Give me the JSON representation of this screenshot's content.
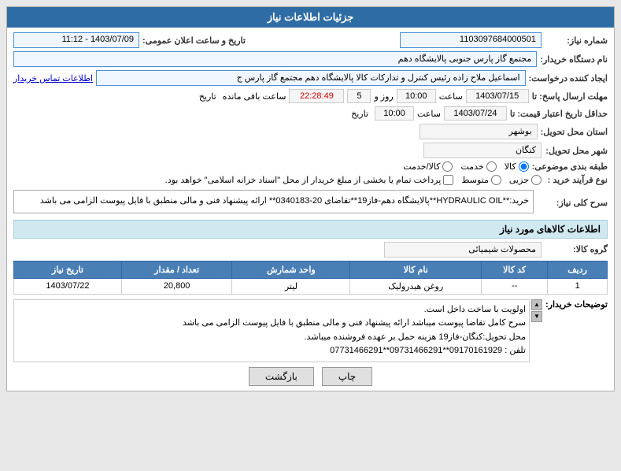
{
  "page": {
    "title": "جزئیات اطلاعات نیاز"
  },
  "fields": {
    "shomareNiaz_label": "شماره نیاز:",
    "shomareNiaz_value": "1103097684000501",
    "namDastgah_label": "نام دستگاه خریدار:",
    "namDastgah_value": "مجتمع گاز پارس جنوبی  پالایشگاه دهم",
    "ijadKonande_label": "ایجاد کننده درخواست:",
    "ijadKonande_value": "اسماعیل ملاح زاده رئیس کنترل و تدارکات کالا پالایشگاه دهم مجتمع گاز پارس ج",
    "etelaatTamas_text": "اطلاعات تماس خریدار",
    "mohlatErsalPasox_label": "مهلت ارسال پاسخ: تا",
    "mohlatErsalPasox_date": "1403/07/15",
    "mohlatErsalPasox_saat": "10:00",
    "mohlatErsalPasox_roz": "5",
    "mohlatErsalPasox_saat_mande": "22:28:49",
    "mohlatErsalPasox_label2": "ساعت باقی مانده",
    "tarikh_label": "تاریخ",
    "hadaqalTarikh_label": "حداقل تاریخ اعتبار قیمت: تا",
    "hadaqalTarikh_date": "1403/07/24",
    "hadaqalTarikh_saat": "10:00",
    "ostan_label": "استان محل تحویل:",
    "ostan_value": "بوشهر",
    "shahr_label": "شهر محل تحویل:",
    "shahr_value": "کنگان",
    "tabaqebandi_label": "طبقه بندی موضوعی:",
    "tabaqebandi_options": [
      "کالا",
      "خدمت",
      "کالا/خدمت"
    ],
    "tabaqebandi_selected": "کالا",
    "noveFaraind_label": "نوع فرآیند خرید :",
    "noveFaraind_options": [
      "جزیی",
      "متوسط",
      "پرداخت تمام یا بخشی از مبلغ خریدار از محل \"اسناد خزانه اسلامی\" خواهد بود."
    ],
    "tarikh_label_main": "تاریخ و ساعت اعلان عمومی:",
    "tarikh_value_main": "1403/07/09 - 11:12",
    "sarij_label": "سرح کلی نیاز:",
    "sarij_value": "خرید:**HYDRAULIC OIL**پالایشگاه دهم-فاز19**تقاضای 20-0340183** ارائه پیشنهاد فنی و مالی منطبق با فایل پیوست الزامی می باشد",
    "ettelaatKala_title": "اطلاعات کالاهای مورد نیاز",
    "geroheKala_label": "گروه کالا:",
    "geroheKala_value": "محصولات شیمیائی",
    "table": {
      "headers": [
        "ردیف",
        "کد کالا",
        "نام کالا",
        "واحد شمارش",
        "تعداد / مقدار",
        "تاریخ نیاز"
      ],
      "rows": [
        [
          "1",
          "--",
          "روغن هیدرولیک",
          "لیتر",
          "20,800",
          "1403/07/22"
        ]
      ]
    },
    "notes_label": "توضیحات خریدار:",
    "notes_line1": "اولویت با ساخت داخل است.",
    "notes_line2": "سرح کامل تقاضا پیوست میباشد ارائه پیشنهاد فنی و مالی منطبق با فایل پیوست الزامی می باشد",
    "notes_line3": "محل تحویل:کنگان-فاز19 هزینه حمل بر عهده فروشنده میباشد.",
    "notes_line4": "تلفن : 09170161929**09731466291**07731466291",
    "btn_baZgasht": "بازگشت",
    "btn_chap": "چاپ"
  }
}
